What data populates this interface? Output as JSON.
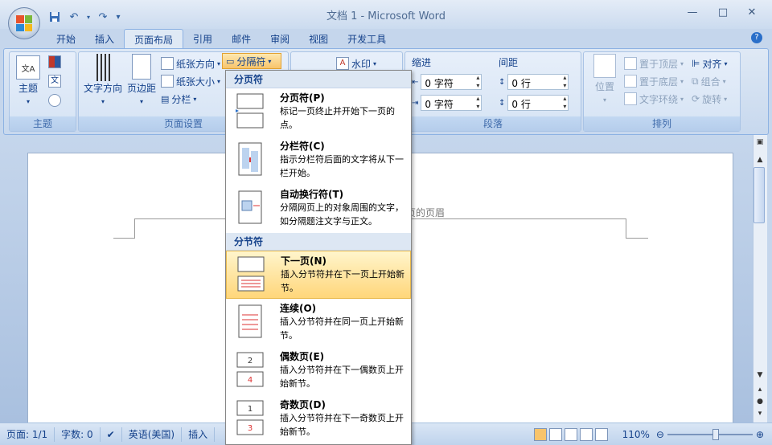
{
  "window": {
    "title": "文档 1 - Microsoft Word",
    "controls": [
      "—",
      "□",
      "✕"
    ]
  },
  "qat": {
    "save": "save-icon",
    "undo": "↶",
    "redo": "↷"
  },
  "tabs": [
    "开始",
    "插入",
    "页面布局",
    "引用",
    "邮件",
    "审阅",
    "视图",
    "开发工具"
  ],
  "active_tab": "页面布局",
  "ribbon": {
    "theme_group": {
      "label": "主题",
      "button": "主题"
    },
    "page_setup": {
      "label": "页面设置",
      "text_direction": "文字方向",
      "margins": "页边距",
      "orientation": "纸张方向",
      "size": "纸张大小",
      "columns": "分栏",
      "breaks": "分隔符"
    },
    "background": {
      "watermark": "水印"
    },
    "paragraph": {
      "label": "段落",
      "indent": "缩进",
      "spacing": "间距",
      "indent_left": "0 字符",
      "indent_right": "0 字符",
      "spacing_before": "0 行",
      "spacing_after": "0 行"
    },
    "arrange": {
      "label": "排列",
      "position": "位置",
      "bring_front": "置于顶层",
      "send_back": "置于底层",
      "text_wrap": "文字环绕",
      "align": "对齐",
      "group": "组合",
      "rotate": "旋转"
    }
  },
  "document": {
    "header_hint": "页的页眉"
  },
  "menu": {
    "section1": "分页符",
    "section2": "分节符",
    "items": [
      {
        "title": "分页符(P)",
        "desc": "标记一页终止并开始下一页的点。"
      },
      {
        "title": "分栏符(C)",
        "desc": "指示分栏符后面的文字将从下一栏开始。"
      },
      {
        "title": "自动换行符(T)",
        "desc": "分隔网页上的对象周围的文字，如分隔题注文字与正文。"
      },
      {
        "title": "下一页(N)",
        "desc": "插入分节符并在下一页上开始新节。"
      },
      {
        "title": "连续(O)",
        "desc": "插入分节符并在同一页上开始新节。"
      },
      {
        "title": "偶数页(E)",
        "desc": "插入分节符并在下一偶数页上开始新节。"
      },
      {
        "title": "奇数页(D)",
        "desc": "插入分节符并在下一奇数页上开始新节。"
      }
    ]
  },
  "status": {
    "page": "页面: 1/1",
    "words": "字数: 0",
    "language": "英语(美国)",
    "mode": "插入",
    "zoom": "110%"
  }
}
